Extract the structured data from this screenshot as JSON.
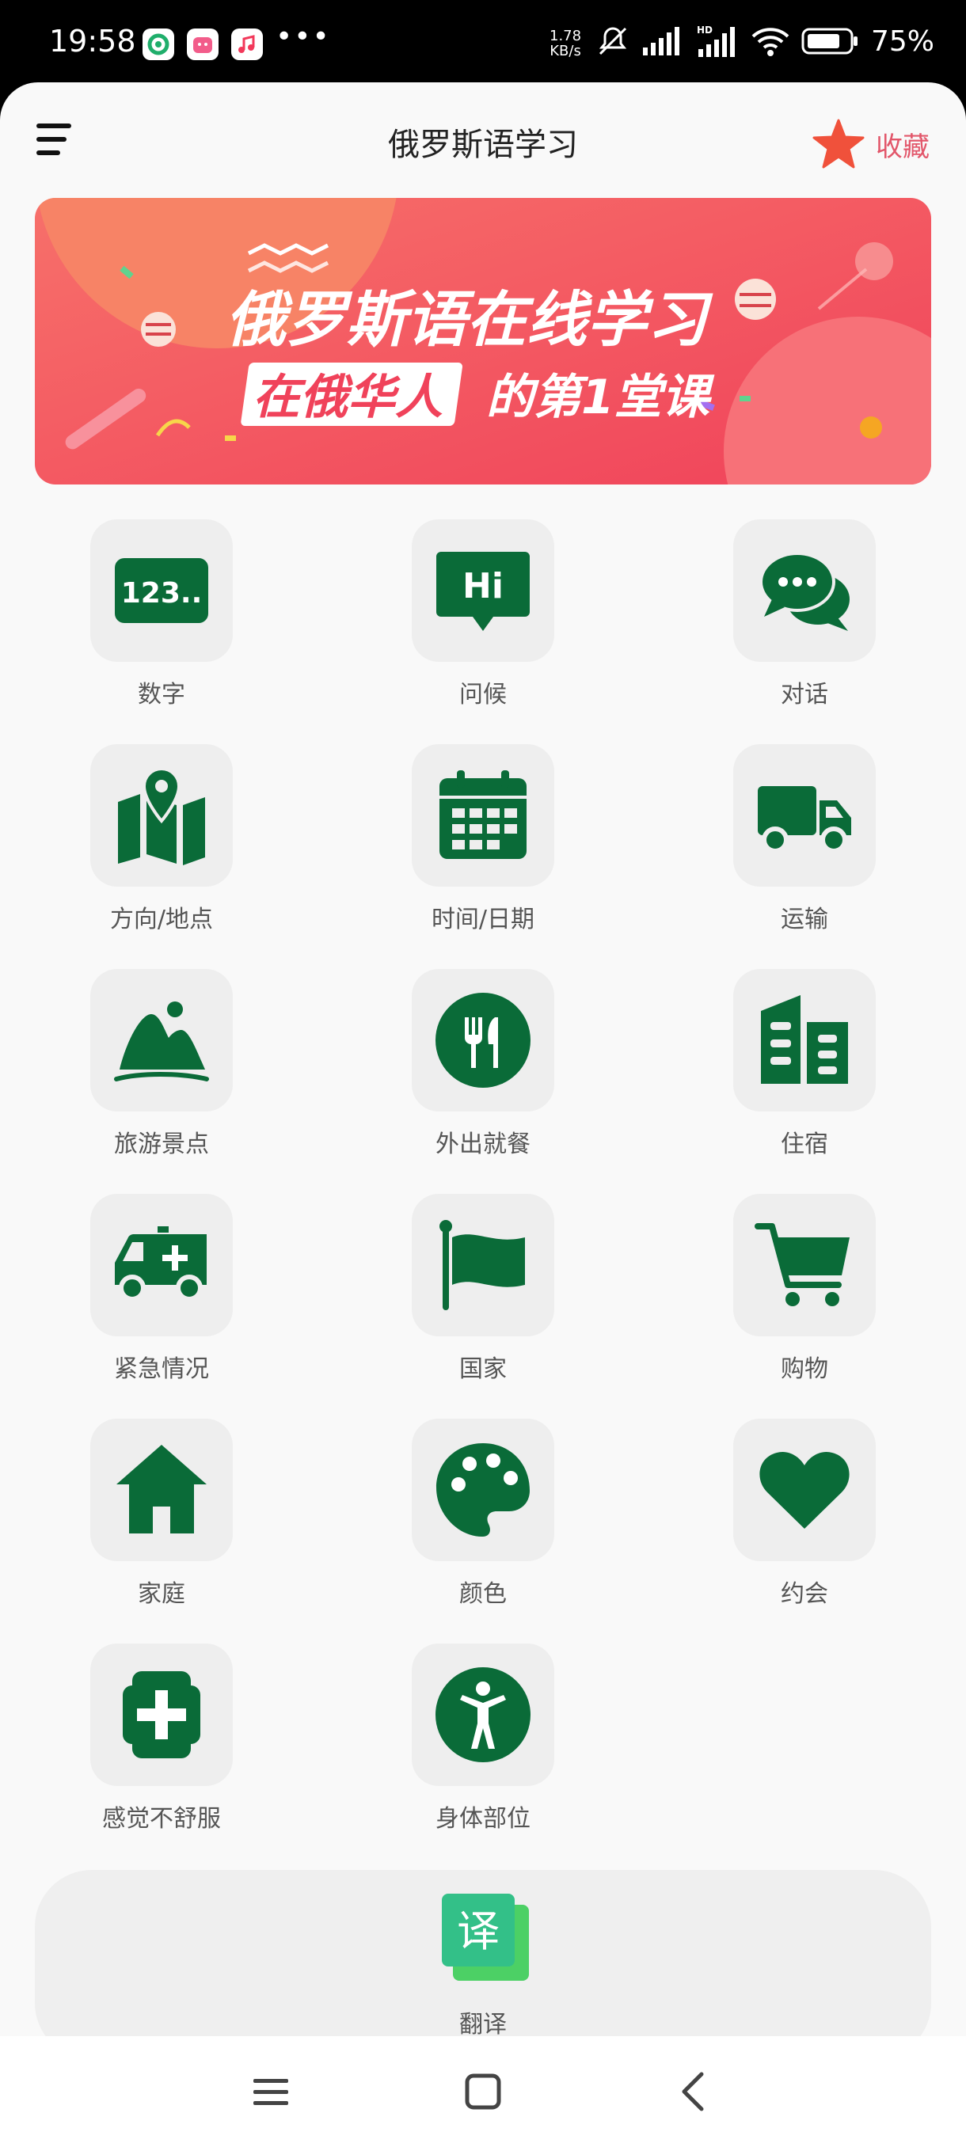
{
  "status_bar": {
    "time": "19:58",
    "speed_value": "1.78",
    "speed_unit": "KB/s",
    "battery": "75%",
    "more": "•••"
  },
  "header": {
    "title": "俄罗斯语学习",
    "favorite_label": "收藏"
  },
  "banner": {
    "headline": "俄罗斯语在线学习",
    "subline_box": "在俄华人",
    "subline_rest": "的第1堂课"
  },
  "grid": {
    "numbers": "数字",
    "greetings": "问候",
    "dialogue": "对话",
    "directions": "方向/地点",
    "datetime": "时间/日期",
    "transport": "运输",
    "sightseeing": "旅游景点",
    "dining": "外出就餐",
    "lodging": "住宿",
    "emergency": "紧急情况",
    "country": "国家",
    "shopping": "购物",
    "family": "家庭",
    "color": "颜色",
    "dating": "约会",
    "unwell": "感觉不舒服",
    "body": "身体部位"
  },
  "icon_text": {
    "numbers": "123..",
    "hi": "Hi",
    "translate": "译"
  },
  "translate": {
    "label": "翻译"
  },
  "colors": {
    "icon_green": "#0a6b38",
    "banner_red": "#f24f5c",
    "star": "#f0513b"
  }
}
